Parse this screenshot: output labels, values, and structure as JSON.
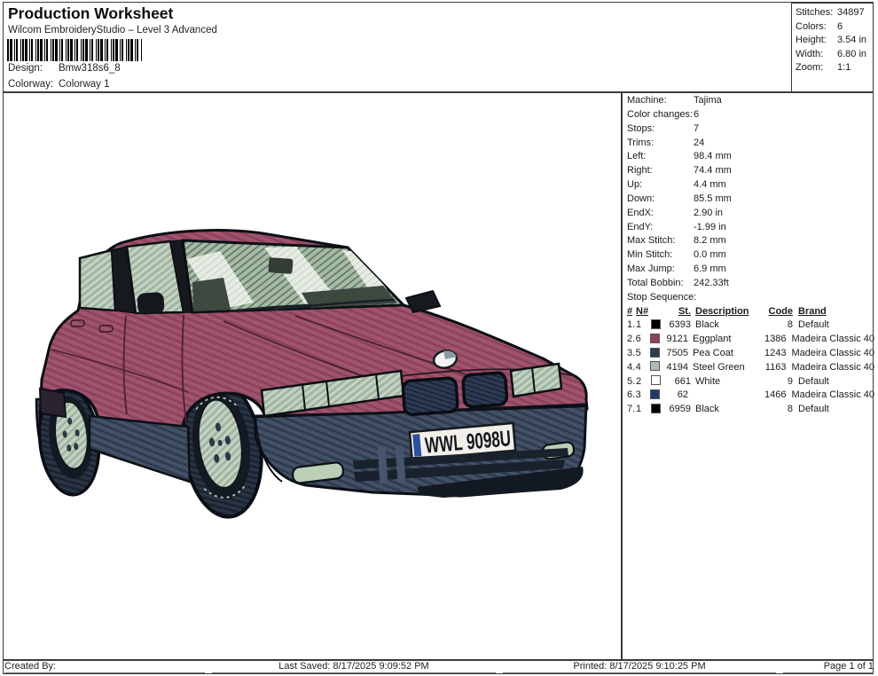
{
  "header": {
    "title": "Production Worksheet",
    "subtitle": "Wilcom EmbroideryStudio – Level 3 Advanced",
    "design_label": "Design:",
    "design_value": "Bmw318s6_8",
    "colorway_label": "Colorway:",
    "colorway_value": "Colorway 1"
  },
  "summary": {
    "rows": [
      {
        "label": "Stitches:",
        "value": "34897"
      },
      {
        "label": "Colors:",
        "value": "6"
      },
      {
        "label": "Height:",
        "value": "3.54 in"
      },
      {
        "label": "Width:",
        "value": "6.80 in"
      },
      {
        "label": "Zoom:",
        "value": "1:1"
      }
    ]
  },
  "machine_info": {
    "rows": [
      {
        "label": "Machine:",
        "value": "Tajima"
      },
      {
        "label": "Color changes:",
        "value": "6"
      },
      {
        "label": "Stops:",
        "value": "7"
      },
      {
        "label": "Trims:",
        "value": "24"
      },
      {
        "label": "Left:",
        "value": "98.4 mm"
      },
      {
        "label": "Right:",
        "value": "74.4 mm"
      },
      {
        "label": "Up:",
        "value": "4.4 mm"
      },
      {
        "label": "Down:",
        "value": "85.5 mm"
      },
      {
        "label": "EndX:",
        "value": "2.90 in"
      },
      {
        "label": "EndY:",
        "value": "-1.99 in"
      },
      {
        "label": "Max Stitch:",
        "value": "8.2 mm"
      },
      {
        "label": "Min Stitch:",
        "value": "0.0 mm"
      },
      {
        "label": "Max Jump:",
        "value": "6.9 mm"
      },
      {
        "label": "Total Bobbin:",
        "value": "242.33ft"
      }
    ]
  },
  "stop_sequence": {
    "title": "Stop Sequence:",
    "headers": [
      "#",
      "N#",
      "St.",
      "Description",
      "Code",
      "Brand"
    ],
    "rows": [
      {
        "num": "1.",
        "n": "1",
        "swatch": "#000000",
        "st": "6393",
        "description": "Black",
        "code": "8",
        "brand": "Default"
      },
      {
        "num": "2.",
        "n": "6",
        "swatch": "#8e4060",
        "st": "9121",
        "description": "Eggplant",
        "code": "1386",
        "brand": "Madeira Classic 40"
      },
      {
        "num": "3.",
        "n": "5",
        "swatch": "#2e3e52",
        "st": "7505",
        "description": "Pea Coat",
        "code": "1243",
        "brand": "Madeira Classic 40"
      },
      {
        "num": "4.",
        "n": "4",
        "swatch": "#aebcb4",
        "st": "4194",
        "description": "Steel Green",
        "code": "1163",
        "brand": "Madeira Classic 40"
      },
      {
        "num": "5.",
        "n": "2",
        "swatch": "#ffffff",
        "st": "661",
        "description": "White",
        "code": "9",
        "brand": "Default"
      },
      {
        "num": "6.",
        "n": "3",
        "swatch": "#1f3a70",
        "st": "62",
        "description": "",
        "code": "1466",
        "brand": "Madeira Classic 40"
      },
      {
        "num": "7.",
        "n": "1",
        "swatch": "#000000",
        "st": "6959",
        "description": "Black",
        "code": "8",
        "brand": "Default"
      }
    ]
  },
  "design": {
    "license_plate": {
      "text": "WWL 9098U",
      "stripe_color": "#2c4fa3"
    },
    "palette": {
      "body_eggplant": "#9c4e68",
      "bumper_pea_coat": "#3d4b60",
      "glass_steel_green": "#b5c6b4",
      "outline_black": "#0c1016",
      "reflection_white": "#e6ece3"
    }
  },
  "footer": {
    "created_by": "Created By:",
    "last_saved": "Last Saved: 8/17/2025 9:09:52 PM",
    "printed": "Printed: 8/17/2025 9:10:25 PM",
    "page": "Page 1 of 1"
  }
}
